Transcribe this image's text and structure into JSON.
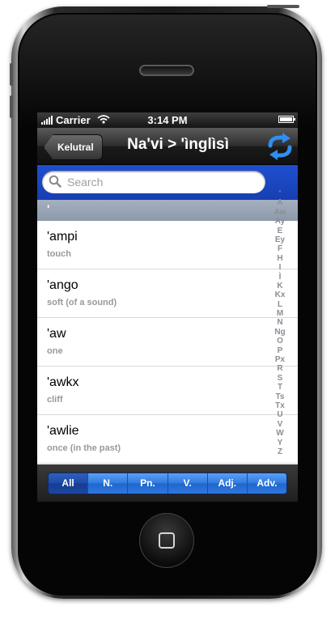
{
  "status_bar": {
    "carrier": "Carrier",
    "time": "3:14 PM"
  },
  "nav": {
    "back_label": "Kelutral",
    "title": "Na'vi > 'ìnglìsì",
    "refresh_icon": "refresh-icon"
  },
  "search": {
    "placeholder": "Search",
    "value": ""
  },
  "section": {
    "header": "'"
  },
  "words": [
    {
      "term": "'ampi",
      "definition": "touch"
    },
    {
      "term": "'ango",
      "definition": "soft (of a sound)"
    },
    {
      "term": "'aw",
      "definition": "one"
    },
    {
      "term": "'awkx",
      "definition": "cliff"
    },
    {
      "term": "'awlie",
      "definition": "once (in the past)"
    }
  ],
  "index_letters": [
    "'",
    "A",
    "Aw",
    "Ay",
    "E",
    "Ey",
    "F",
    "H",
    "I",
    "Ì",
    "K",
    "Kx",
    "L",
    "M",
    "N",
    "Ng",
    "O",
    "P",
    "Px",
    "R",
    "S",
    "T",
    "Ts",
    "Tx",
    "U",
    "V",
    "W",
    "Y",
    "Z"
  ],
  "filters": {
    "selected": "All",
    "segments": [
      "All",
      "N.",
      "Pn.",
      "V.",
      "Adj.",
      "Adv."
    ]
  },
  "colors": {
    "accent_blue": "#1f4fd0",
    "segment_blue": "#2f7ae0"
  }
}
